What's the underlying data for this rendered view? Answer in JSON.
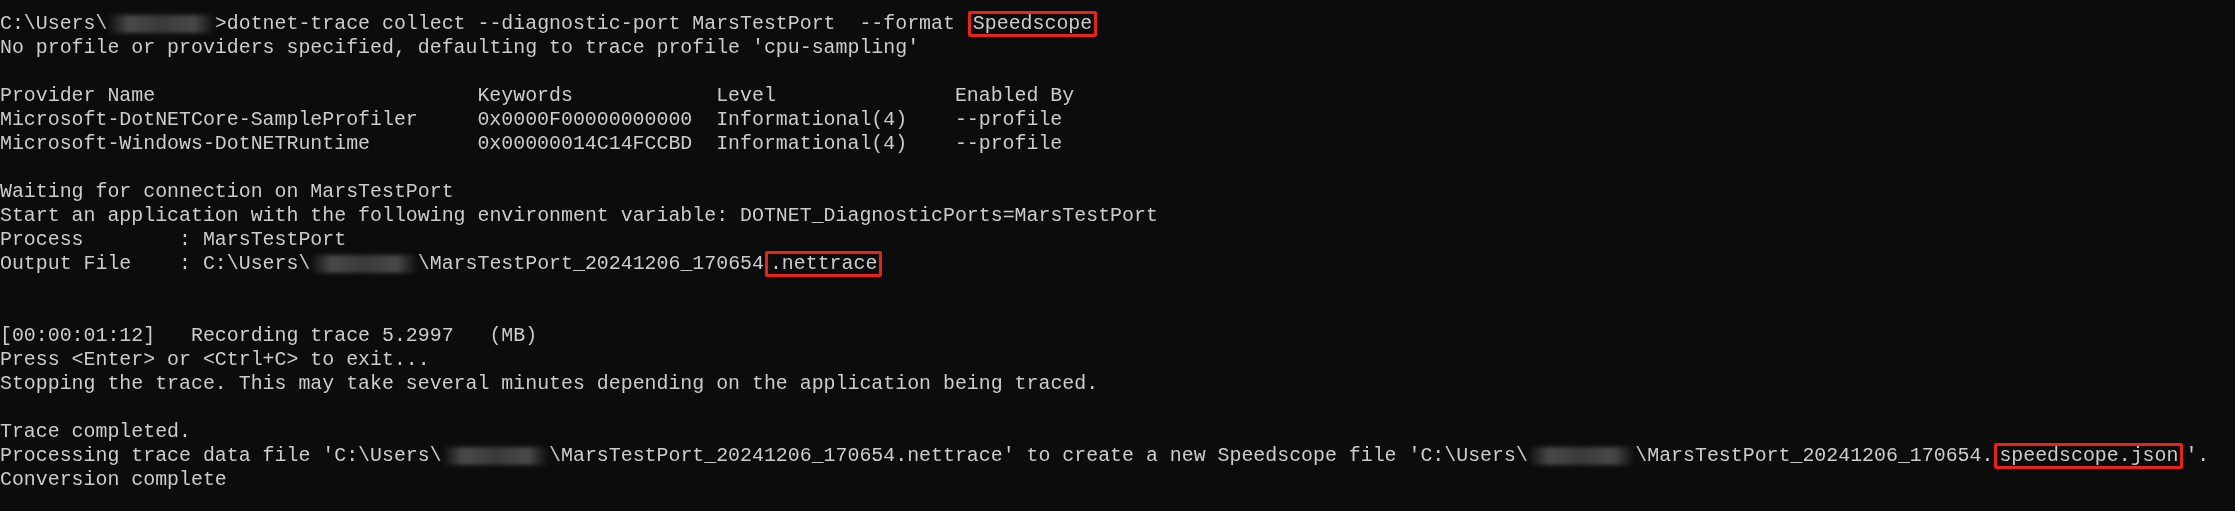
{
  "lines": [
    {
      "kind": "text",
      "segments": [
        {
          "kind": "text",
          "text": "C:\\Users\\"
        },
        {
          "kind": "redacted"
        },
        {
          "kind": "text",
          "text": ">dotnet-trace collect --diagnostic-port MarsTestPort  --format "
        },
        {
          "kind": "highlight",
          "text": "Speedscope"
        }
      ]
    },
    {
      "kind": "text",
      "segments": [
        {
          "kind": "text",
          "text": "No profile or providers specified, defaulting to trace profile 'cpu-sampling'"
        }
      ]
    },
    {
      "kind": "blank"
    },
    {
      "kind": "columns",
      "cells": [
        "Provider Name",
        "Keywords",
        "Level",
        "Enabled By"
      ]
    },
    {
      "kind": "columns",
      "cells": [
        "Microsoft-DotNETCore-SampleProfiler",
        "0x0000F00000000000",
        "Informational(4)",
        "--profile"
      ]
    },
    {
      "kind": "columns",
      "cells": [
        "Microsoft-Windows-DotNETRuntime",
        "0x00000014C14FCCBD",
        "Informational(4)",
        "--profile"
      ]
    },
    {
      "kind": "blank"
    },
    {
      "kind": "text",
      "segments": [
        {
          "kind": "text",
          "text": "Waiting for connection on MarsTestPort"
        }
      ]
    },
    {
      "kind": "text",
      "segments": [
        {
          "kind": "text",
          "text": "Start an application with the following environment variable: DOTNET_DiagnosticPorts=MarsTestPort"
        }
      ]
    },
    {
      "kind": "text",
      "segments": [
        {
          "kind": "text",
          "text": "Process        : MarsTestPort"
        }
      ]
    },
    {
      "kind": "text",
      "segments": [
        {
          "kind": "text",
          "text": "Output File    : C:\\Users\\"
        },
        {
          "kind": "redacted"
        },
        {
          "kind": "text",
          "text": "\\MarsTestPort_20241206_170654"
        },
        {
          "kind": "highlight",
          "text": ".nettrace"
        }
      ]
    },
    {
      "kind": "blank"
    },
    {
      "kind": "blank"
    },
    {
      "kind": "text",
      "segments": [
        {
          "kind": "text",
          "text": "[00:00:01:12]   Recording trace 5.2997   (MB)"
        }
      ]
    },
    {
      "kind": "text",
      "segments": [
        {
          "kind": "text",
          "text": "Press <Enter> or <Ctrl+C> to exit..."
        }
      ]
    },
    {
      "kind": "text",
      "segments": [
        {
          "kind": "text",
          "text": "Stopping the trace. This may take several minutes depending on the application being traced."
        }
      ]
    },
    {
      "kind": "blank"
    },
    {
      "kind": "text",
      "segments": [
        {
          "kind": "text",
          "text": "Trace completed."
        }
      ]
    },
    {
      "kind": "text",
      "segments": [
        {
          "kind": "text",
          "text": "Processing trace data file 'C:\\Users\\"
        },
        {
          "kind": "redacted"
        },
        {
          "kind": "text",
          "text": "\\MarsTestPort_20241206_170654.nettrace' to create a new Speedscope file 'C:\\Users\\"
        },
        {
          "kind": "redacted"
        },
        {
          "kind": "text",
          "text": "\\MarsTestPort_20241206_170654."
        },
        {
          "kind": "highlight",
          "text": "speedscope.json"
        },
        {
          "kind": "text",
          "text": "'."
        }
      ]
    },
    {
      "kind": "text",
      "segments": [
        {
          "kind": "text",
          "text": "Conversion complete"
        }
      ]
    }
  ]
}
